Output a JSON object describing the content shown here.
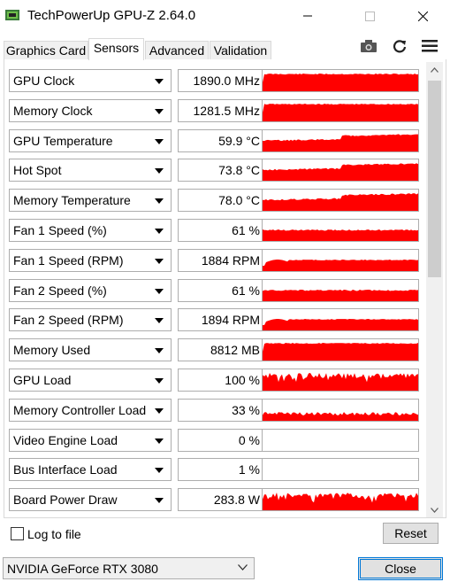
{
  "window": {
    "title": "TechPowerUp GPU-Z 2.64.0"
  },
  "tabs": [
    {
      "label": "Graphics Card"
    },
    {
      "label": "Sensors"
    },
    {
      "label": "Advanced"
    },
    {
      "label": "Validation"
    }
  ],
  "toolbar": {
    "icons": [
      "camera-icon",
      "refresh-icon",
      "menu-icon"
    ]
  },
  "colors": {
    "graph": "#ff0000",
    "accent": "#0078d7"
  },
  "sensors": [
    {
      "name": "GPU Clock",
      "value": "1890.0 MHz",
      "graph": "full"
    },
    {
      "name": "Memory Clock",
      "value": "1281.5 MHz",
      "graph": "full"
    },
    {
      "name": "GPU Temperature",
      "value": "59.9 °C",
      "graph": "high"
    },
    {
      "name": "Hot Spot",
      "value": "73.8 °C",
      "graph": "high"
    },
    {
      "name": "Memory Temperature",
      "value": "78.0 °C",
      "graph": "high"
    },
    {
      "name": "Fan 1 Speed (%)",
      "value": "61 %",
      "graph": "mid"
    },
    {
      "name": "Fan 1 Speed (RPM)",
      "value": "1884 RPM",
      "graph": "dip"
    },
    {
      "name": "Fan 2 Speed (%)",
      "value": "61 %",
      "graph": "mid"
    },
    {
      "name": "Fan 2 Speed (RPM)",
      "value": "1894 RPM",
      "graph": "dip"
    },
    {
      "name": "Memory Used",
      "value": "8812 MB",
      "graph": "full"
    },
    {
      "name": "GPU Load",
      "value": "100 %",
      "graph": "noisy"
    },
    {
      "name": "Memory Controller Load",
      "value": "33 %",
      "graph": "lowmid"
    },
    {
      "name": "Video Engine Load",
      "value": "0 %",
      "graph": "none"
    },
    {
      "name": "Bus Interface Load",
      "value": "1 %",
      "graph": "none"
    },
    {
      "name": "Board Power Draw",
      "value": "283.8 W",
      "graph": "noisy"
    },
    {
      "name": "",
      "value": "",
      "graph": "none"
    }
  ],
  "footer": {
    "log_label": "Log to file",
    "reset_label": "Reset",
    "gpu_selected": "NVIDIA GeForce RTX 3080",
    "close_label": "Close"
  }
}
